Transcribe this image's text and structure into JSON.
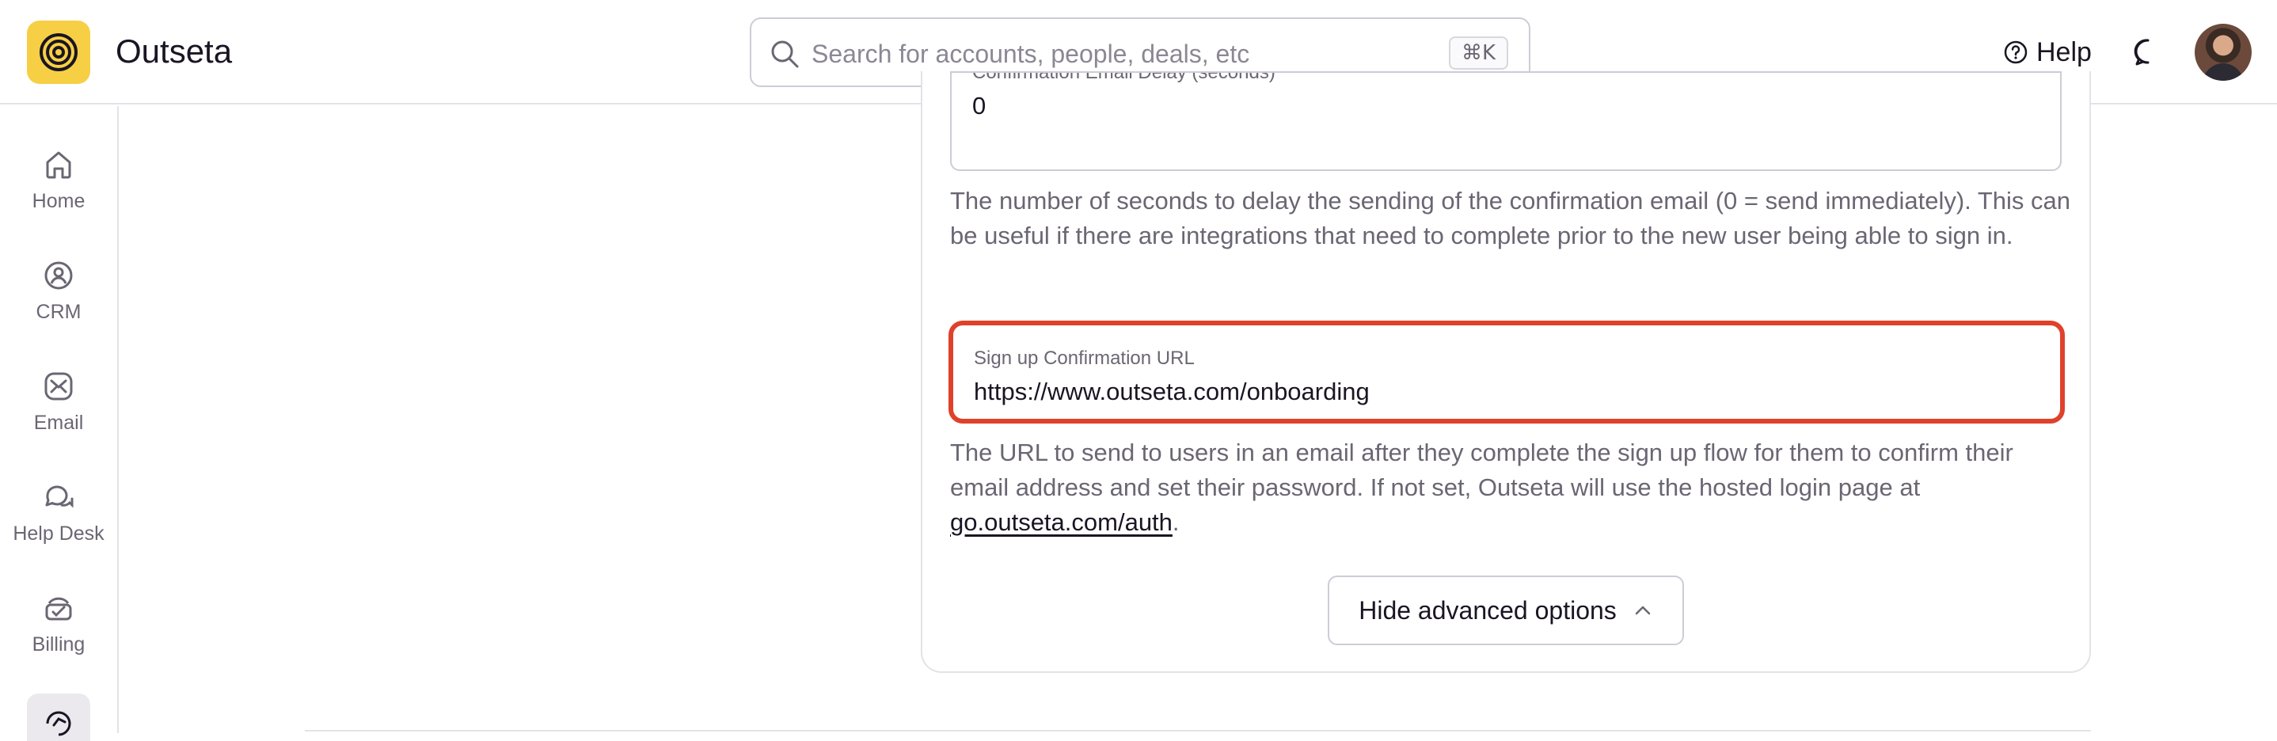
{
  "app": {
    "name": "Outseta"
  },
  "search": {
    "placeholder": "Search for accounts, people, deals, etc",
    "shortcut": "⌘K"
  },
  "header": {
    "help_label": "Help"
  },
  "sidebar": {
    "items": [
      {
        "label": "Home",
        "icon": "home-icon"
      },
      {
        "label": "CRM",
        "icon": "crm-icon"
      },
      {
        "label": "Email",
        "icon": "email-icon"
      },
      {
        "label": "Help Desk",
        "icon": "help-desk-icon"
      },
      {
        "label": "Billing",
        "icon": "billing-icon"
      }
    ]
  },
  "form": {
    "delay_field": {
      "label": "Confirmation Email Delay (seconds)",
      "value": "0",
      "help": "The number of seconds to delay the sending of the confirmation email (0 = send immediately). This can be useful if there are integrations that need to complete prior to the new user being able to sign in."
    },
    "confirmation_url_field": {
      "label": "Sign up Confirmation URL",
      "value": "https://www.outseta.com/onboarding",
      "help_prefix": "The URL to send to users in an email after they complete the sign up flow for them to confirm their email address and set their password. If not set, Outseta will use the hosted login page at ",
      "help_link": "go.outseta.com/auth",
      "help_suffix": "."
    },
    "advanced_toggle_label": "Hide advanced options"
  },
  "colors": {
    "brand": "#f6cf45",
    "highlight": "#e0412a",
    "muted_text": "#6b6673"
  }
}
